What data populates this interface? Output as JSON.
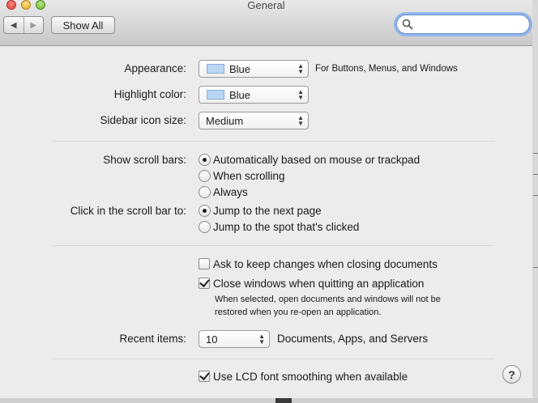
{
  "window": {
    "title": "General"
  },
  "toolbar": {
    "back": "◀",
    "forward": "▶",
    "show_all": "Show All"
  },
  "search": {
    "value": "",
    "placeholder": ""
  },
  "appearance": {
    "label": "Appearance:",
    "value": "Blue",
    "note": "For Buttons, Menus, and Windows"
  },
  "highlight": {
    "label": "Highlight color:",
    "value": "Blue"
  },
  "sidebar_icon": {
    "label": "Sidebar icon size:",
    "value": "Medium"
  },
  "scroll_bars": {
    "label": "Show scroll bars:",
    "options": [
      "Automatically based on mouse or trackpad",
      "When scrolling",
      "Always"
    ],
    "selected": 0
  },
  "click_scroll": {
    "label": "Click in the scroll bar to:",
    "options": [
      "Jump to the next page",
      "Jump to the spot that's clicked"
    ],
    "selected": 0
  },
  "checks": {
    "ask_keep": {
      "label": "Ask to keep changes when closing documents",
      "checked": false
    },
    "close_windows": {
      "label": "Close windows when quitting an application",
      "checked": true,
      "description": "When selected, open documents and windows will not be restored when you re-open an application."
    },
    "lcd_smoothing": {
      "label": "Use LCD font smoothing when available",
      "checked": true
    }
  },
  "recent": {
    "label": "Recent items:",
    "value": "10",
    "note": "Documents, Apps, and Servers"
  },
  "help": {
    "label": "?"
  },
  "colors": {
    "accent_swatch": "#b9d6f4",
    "search_focus": "#8fb6ea"
  }
}
